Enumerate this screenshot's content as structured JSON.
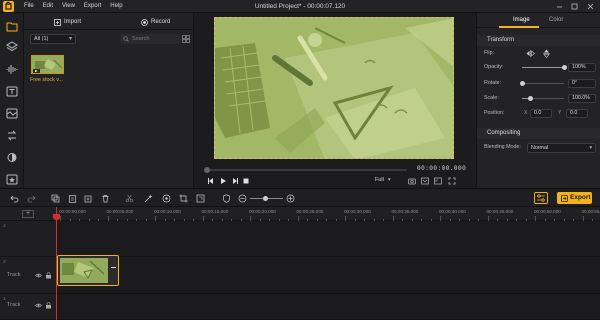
{
  "app": {
    "window_title": "Untitled Project* - 00:00:07.120",
    "menu": [
      "File",
      "Edit",
      "View",
      "Export",
      "Help"
    ],
    "accent_color": "#f3b21b"
  },
  "rail": {
    "items": [
      "media-icon",
      "layers-icon",
      "audio-icon",
      "text-icon",
      "sticker-icon",
      "transition-icon",
      "filter-icon",
      "effect-icon"
    ]
  },
  "media": {
    "import_label": "Import",
    "record_label": "Record",
    "filter_value": "All (1)",
    "search_placeholder": "Search",
    "item_label": "Free stock v..."
  },
  "preview": {
    "timecode": "00:00:00.000",
    "quality": "Full"
  },
  "properties": {
    "tabs": [
      "Image",
      "Color"
    ],
    "active_tab": "Image",
    "transform_label": "Transform",
    "flip_label": "Flip:",
    "opacity_label": "Opacity:",
    "opacity_value": "100%",
    "opacity_level": 1.0,
    "rotate_label": "Rotate:",
    "rotate_value": "0°",
    "rotate_level": 0.0,
    "scale_label": "Scale:",
    "scale_value": "100.0%",
    "scale_level": 0.2,
    "position_label": "Position:",
    "pos_x_label": "X",
    "pos_x_value": "0.0",
    "pos_y_label": "Y",
    "pos_y_value": "0.0",
    "compositing_label": "Compositing",
    "blend_label": "Blending Mode:",
    "blend_value": "Normal"
  },
  "toolbar": {
    "export_label": "Export",
    "zoom_level": 0.5
  },
  "timeline": {
    "ruler_labels": [
      "00:00:00.000",
      "00:00:05.000",
      "00:00:10.000",
      "00:00:15.000",
      "00:00:20.000",
      "00:00:25.000",
      "00:00:30.000",
      "00:00:35.000",
      "00:00:40.000",
      "00:00:45.000",
      "00:00:50.000",
      "00:00:55.000"
    ],
    "tracks": [
      {
        "num": "3",
        "name": ""
      },
      {
        "num": "2",
        "name": "Track"
      },
      {
        "num": "1",
        "name": "Track"
      }
    ]
  }
}
